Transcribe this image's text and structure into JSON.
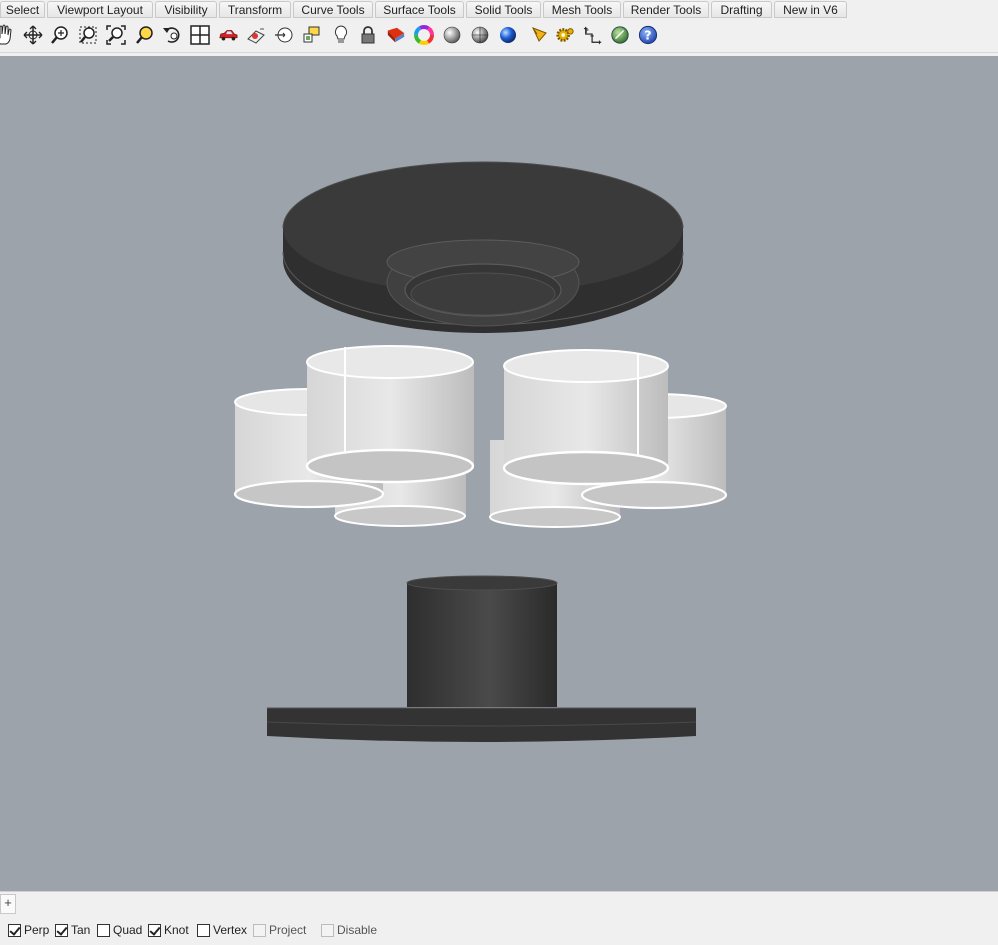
{
  "tabs": [
    "Select",
    "Viewport Layout",
    "Visibility",
    "Transform",
    "Curve Tools",
    "Surface Tools",
    "Solid Tools",
    "Mesh Tools",
    "Render Tools",
    "Drafting",
    "New in V6"
  ],
  "toolbar_icons": [
    "pan-hand-icon",
    "rotate-view-icon",
    "zoom-dynamic-icon",
    "zoom-window-icon",
    "zoom-extents-icon",
    "zoom-selected-icon",
    "undo-view-icon",
    "four-viewports-icon",
    "car-icon",
    "named-view-icon",
    "clipping-plane-icon",
    "light-bulb-icon",
    "lock-icon",
    "shaded-icon",
    "color-wheel-icon",
    "rendered-sphere-icon",
    "ghosted-sphere-icon",
    "blue-sphere-icon",
    "pencil-tools-icon",
    "gear-icon",
    "dimension-icon",
    "globe-icon",
    "help-icon"
  ],
  "colors": {
    "viewport_bg": "#9ca3ab",
    "dark_part": "#3a3a3a",
    "light_part": "#e2e2e2",
    "edge_highlight": "#ffffff"
  },
  "statusbar": {
    "add_symbol": "+",
    "osnaps": [
      {
        "label": "Perp",
        "checked": true,
        "disabled": false
      },
      {
        "label": "Tan",
        "checked": true,
        "disabled": false
      },
      {
        "label": "Quad",
        "checked": false,
        "disabled": false
      },
      {
        "label": "Knot",
        "checked": true,
        "disabled": false
      },
      {
        "label": "Vertex",
        "checked": false,
        "disabled": false
      },
      {
        "label": "Project",
        "checked": false,
        "disabled": true
      },
      {
        "label": "Disable",
        "checked": false,
        "disabled": true
      }
    ]
  }
}
